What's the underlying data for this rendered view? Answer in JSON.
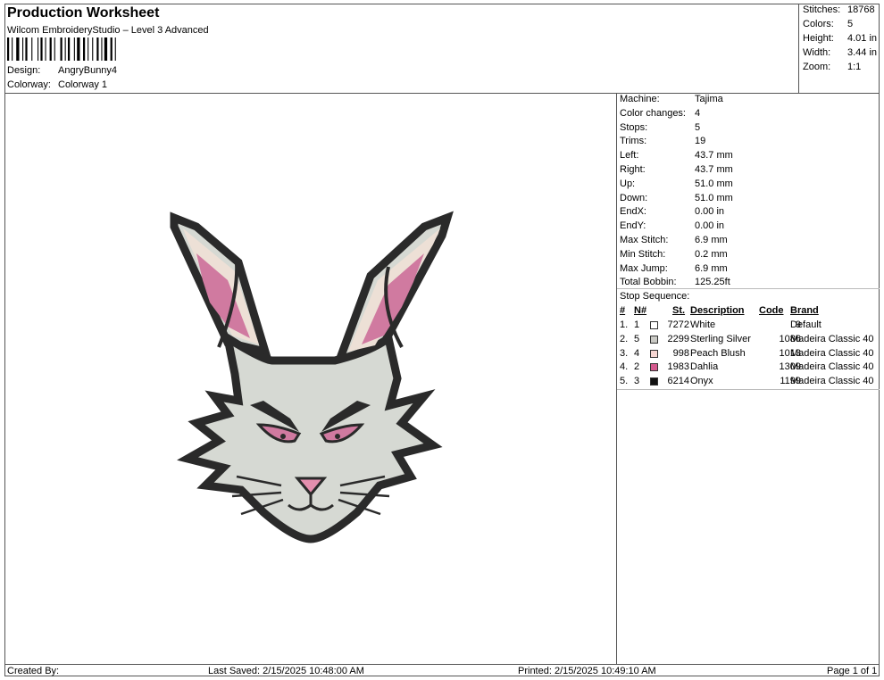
{
  "header": {
    "title": "Production Worksheet",
    "subtitle": "Wilcom EmbroideryStudio – Level 3 Advanced",
    "design_label": "Design:",
    "design_value": "AngryBunny4",
    "colorway_label": "Colorway:",
    "colorway_value": "Colorway 1"
  },
  "stats": [
    {
      "label": "Stitches:",
      "value": "18768"
    },
    {
      "label": "Colors:",
      "value": "5"
    },
    {
      "label": "Height:",
      "value": "4.01 in"
    },
    {
      "label": "Width:",
      "value": "3.44 in"
    },
    {
      "label": "Zoom:",
      "value": "1:1"
    }
  ],
  "machine_info": [
    {
      "label": "Machine:",
      "value": "Tajima"
    },
    {
      "label": "Color changes:",
      "value": "4"
    },
    {
      "label": "Stops:",
      "value": "5"
    },
    {
      "label": "Trims:",
      "value": "19"
    },
    {
      "label": "Left:",
      "value": "43.7 mm"
    },
    {
      "label": "Right:",
      "value": "43.7 mm"
    },
    {
      "label": "Up:",
      "value": "51.0 mm"
    },
    {
      "label": "Down:",
      "value": "51.0 mm"
    },
    {
      "label": "EndX:",
      "value": "0.00 in"
    },
    {
      "label": "EndY:",
      "value": "0.00 in"
    },
    {
      "label": "Max Stitch:",
      "value": "6.9 mm"
    },
    {
      "label": "Min Stitch:",
      "value": "0.2 mm"
    },
    {
      "label": "Max Jump:",
      "value": "6.9 mm"
    },
    {
      "label": "Total Bobbin:",
      "value": "125.25ft"
    }
  ],
  "stop_sequence": {
    "title": "Stop Sequence:",
    "headers": {
      "num": "#",
      "n": "N#",
      "st": "St.",
      "description": "Description",
      "code": "Code",
      "brand": "Brand"
    },
    "rows": [
      {
        "num": "1.",
        "n": "1",
        "color": "#ffffff",
        "st": "7272",
        "description": "White",
        "code": "9",
        "brand": "Default"
      },
      {
        "num": "2.",
        "n": "5",
        "color": "#c9c9c4",
        "st": "2299",
        "description": "Sterling Silver",
        "code": "1086",
        "brand": "Madeira Classic 40"
      },
      {
        "num": "3.",
        "n": "4",
        "color": "#f6d6d2",
        "st": "998",
        "description": "Peach Blush",
        "code": "1013",
        "brand": "Madeira Classic 40"
      },
      {
        "num": "4.",
        "n": "2",
        "color": "#d45a8e",
        "st": "1983",
        "description": "Dahlia",
        "code": "1309",
        "brand": "Madeira Classic 40"
      },
      {
        "num": "5.",
        "n": "3",
        "color": "#111111",
        "st": "6214",
        "description": "Onyx",
        "code": "1199",
        "brand": "Madeira Classic 40"
      }
    ]
  },
  "footer": {
    "created_by": "Created By:",
    "last_saved": "Last Saved: 2/15/2025 10:48:00 AM",
    "printed": "Printed: 2/15/2025 10:49:10 AM",
    "page": "Page 1 of 1"
  }
}
